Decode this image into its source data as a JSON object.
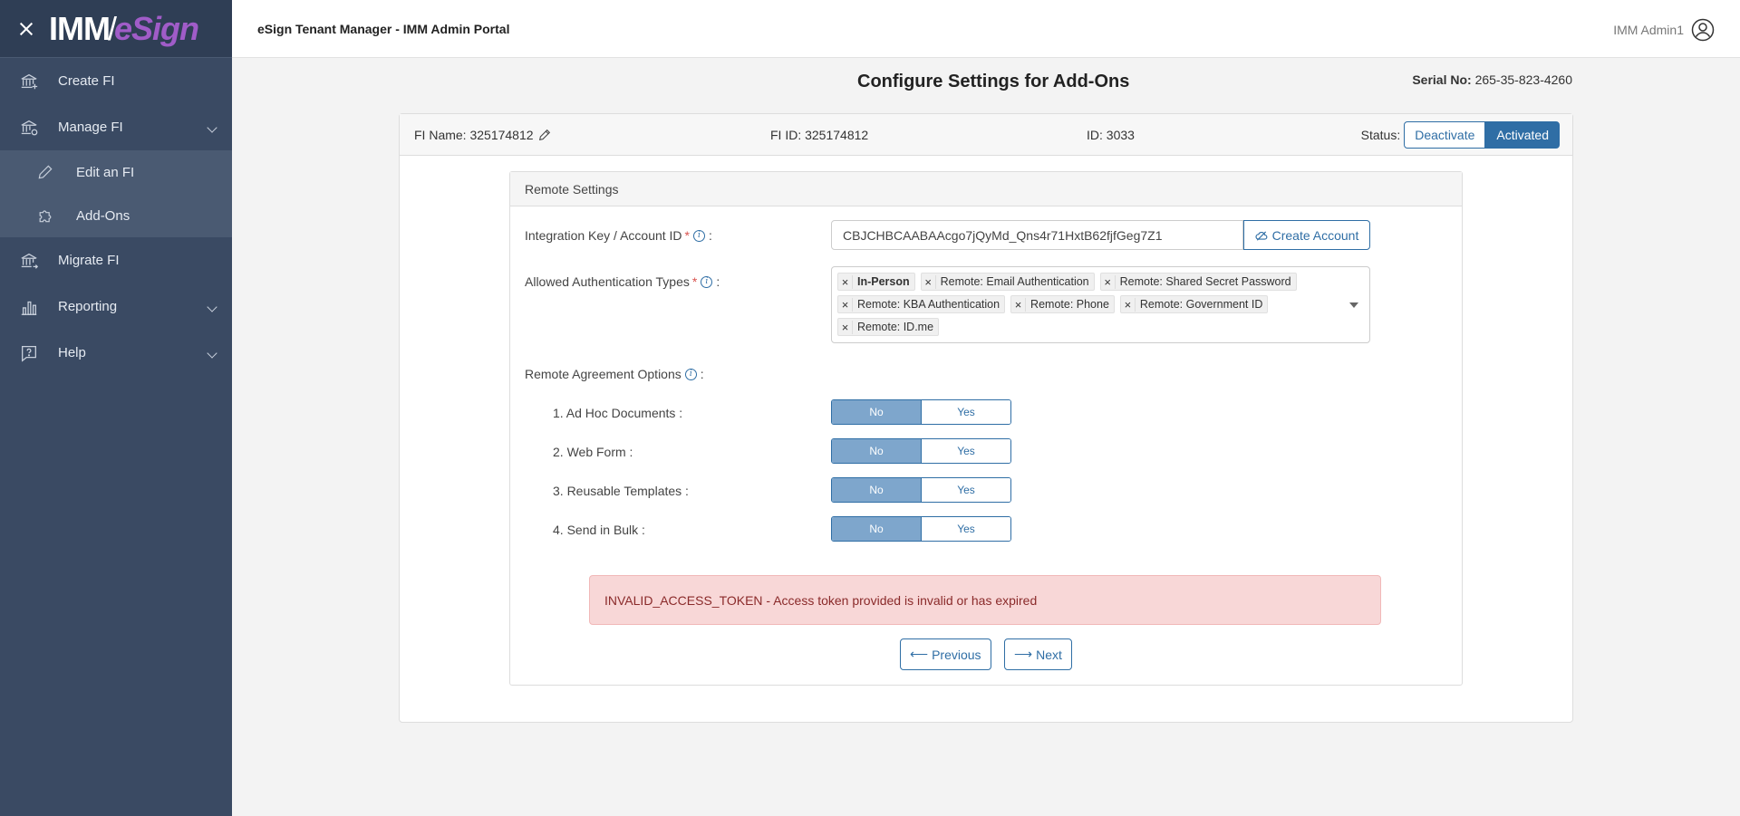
{
  "sidebar": {
    "logo": {
      "imm": "IMM",
      "slash": "/",
      "esign": "eSign"
    },
    "items": [
      {
        "label": "Create FI"
      },
      {
        "label": "Manage FI"
      },
      {
        "label": "Edit an FI"
      },
      {
        "label": "Add-Ons"
      },
      {
        "label": "Migrate FI"
      },
      {
        "label": "Reporting"
      },
      {
        "label": "Help"
      }
    ]
  },
  "header": {
    "title": "eSign Tenant Manager - IMM Admin Portal",
    "user": "IMM Admin1"
  },
  "page": {
    "title": "Configure Settings for Add-Ons",
    "serial_label": "Serial No:",
    "serial_value": "265-35-823-4260"
  },
  "fi": {
    "name_label": "FI Name: 325174812",
    "fi_id": "FI ID: 325174812",
    "id": "ID: 3033",
    "status_label": "Status:",
    "deactivate": "Deactivate",
    "activated": "Activated"
  },
  "remote": {
    "section_title": "Remote Settings",
    "integration_key_label": "Integration Key / Account ID",
    "integration_key_value": "CBJCHBCAABAAcgo7jQyMd_Qns4r71HxtB62fjfGeg7Z1",
    "create_account": "Create Account",
    "auth_types_label": "Allowed Authentication Types",
    "auth_types": [
      "In-Person",
      "Remote: Email Authentication",
      "Remote: Shared Secret Password",
      "Remote: KBA Authentication",
      "Remote: Phone",
      "Remote: Government ID",
      "Remote: ID.me"
    ],
    "agreement_label": "Remote Agreement Options",
    "options": [
      {
        "label": "1. Ad Hoc Documents :",
        "no": "No",
        "yes": "Yes",
        "selected": "No"
      },
      {
        "label": "2. Web Form :",
        "no": "No",
        "yes": "Yes",
        "selected": "No"
      },
      {
        "label": "3. Reusable Templates :",
        "no": "No",
        "yes": "Yes",
        "selected": "No"
      },
      {
        "label": "4. Send in Bulk :",
        "no": "No",
        "yes": "Yes",
        "selected": "No"
      }
    ],
    "error": "INVALID_ACCESS_TOKEN - Access token provided is invalid or has expired",
    "previous": "Previous",
    "next": "Next"
  }
}
